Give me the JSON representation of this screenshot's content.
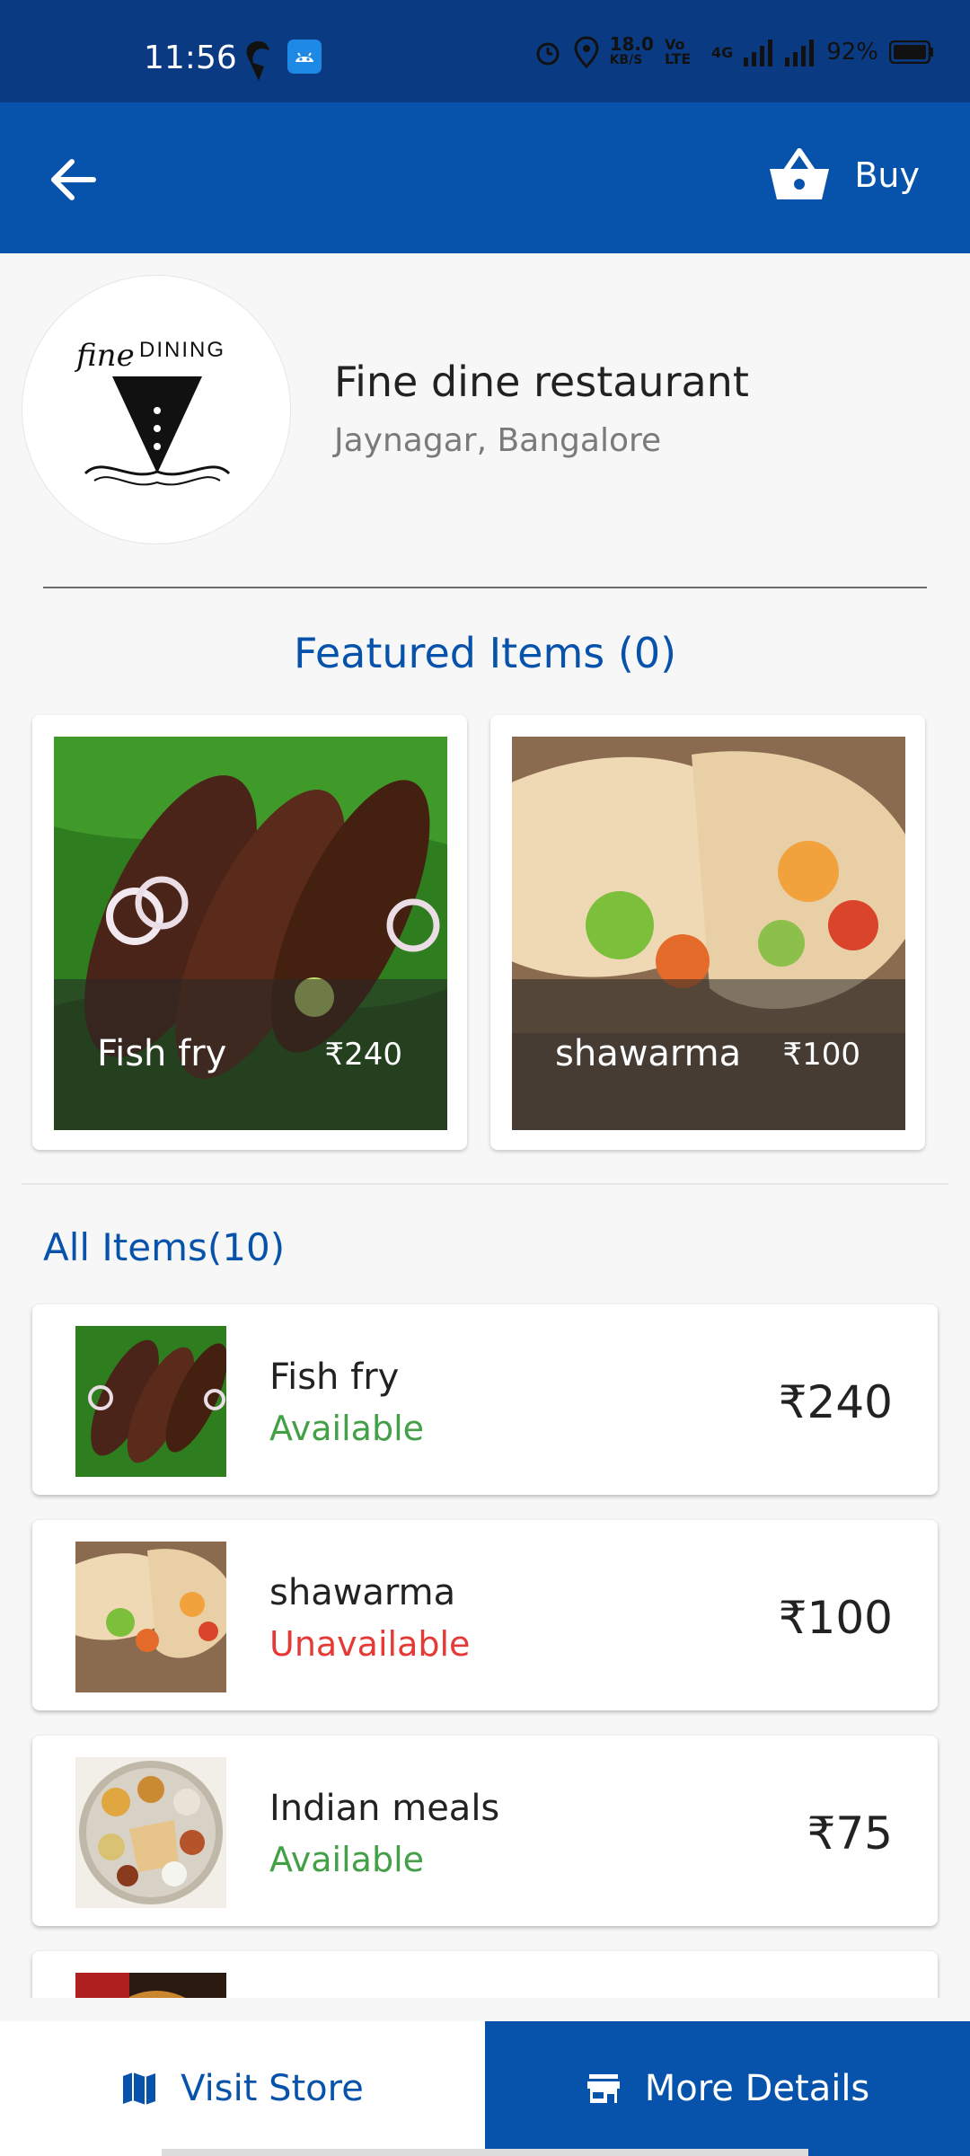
{
  "status_bar": {
    "time": "11:56",
    "network_speed": "18.0",
    "network_speed_unit": "KB/S",
    "volte": "Vo LTE",
    "network_type": "4G",
    "battery": "92%"
  },
  "app_bar": {
    "buy_label": "Buy"
  },
  "restaurant": {
    "name": "Fine dine restaurant",
    "location": "Jaynagar, Bangalore",
    "logo_text": "fine DINING"
  },
  "featured": {
    "title": "Featured Items (0)",
    "items": [
      {
        "name": "Fish fry",
        "price": "₹240"
      },
      {
        "name": "shawarma",
        "price": "₹100"
      }
    ]
  },
  "all_items": {
    "title": "All Items(10)",
    "items": [
      {
        "name": "Fish fry",
        "status": "Available",
        "price": "₹240"
      },
      {
        "name": "shawarma",
        "status": "Unavailable",
        "price": "₹100"
      },
      {
        "name": "Indian meals",
        "status": "Available",
        "price": "₹75"
      }
    ]
  },
  "bottom_bar": {
    "visit_store_label": "Visit Store",
    "more_details_label": "More Details"
  },
  "colors": {
    "primary": "#0753ab",
    "status_bar": "#0a3b82",
    "available": "#43a047",
    "unavailable": "#e53935"
  }
}
